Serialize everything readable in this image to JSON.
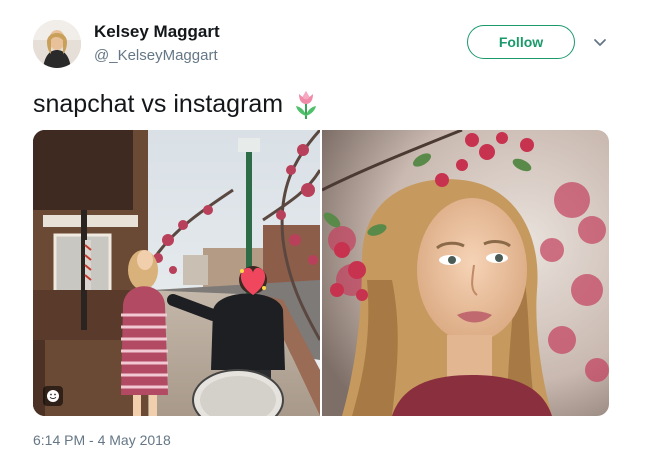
{
  "user": {
    "display_name": "Kelsey Maggart",
    "handle": "@_KelseyMaggart"
  },
  "actions": {
    "follow_label": "Follow",
    "more_icon": "chevron-down-icon"
  },
  "tweet": {
    "text": "snapchat vs instagram",
    "emoji": "tulip-icon",
    "timestamp": "6:14 PM - 4 May 2018"
  },
  "media": {
    "count": 2,
    "sticker_icon": "smiley-sticker-icon",
    "heart_sticker": "heart-emoji-icon"
  },
  "colors": {
    "follow_accent": "#1a9a6b",
    "secondary_text": "#657786",
    "primary_text": "#14171a"
  }
}
